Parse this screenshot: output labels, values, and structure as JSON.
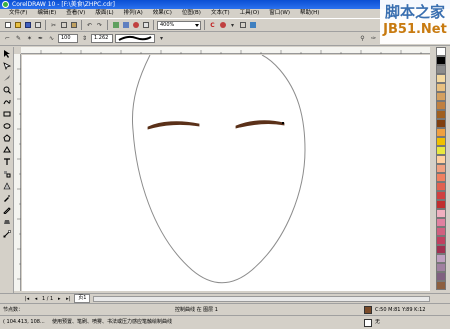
{
  "window": {
    "title": "CorelDRAW 10 - [F:\\美食\\ZHPC.cdr]"
  },
  "menu": [
    "文件(F)",
    "编辑(E)",
    "查看(V)",
    "版面(L)",
    "排列(A)",
    "效果(C)",
    "位图(B)",
    "文本(T)",
    "工具(O)",
    "窗口(W)",
    "帮助(H)"
  ],
  "toolbar": {
    "zoom_value": "400%"
  },
  "property_bar": {
    "width_value": "100",
    "size_value": "1.262"
  },
  "page_nav": {
    "page_counter": "1 / 1",
    "page_tab": "页1"
  },
  "status": {
    "node_info": "节点数：",
    "object_info": "控制曲线 在 图层 1",
    "coords": "( 104.413, 108...",
    "hint": "使用预置、笔刷、喷雾、书法或压力感应笔触绘制曲线",
    "fill_info": "C:50 M:81 Y:89 K:12",
    "outline_info": "无"
  },
  "watermark": {
    "cn": "脚本之家",
    "en": "JB51.Net"
  },
  "palette_colors": [
    "#ffffff",
    "#000000",
    "#8c8c8c",
    "#f4d9a0",
    "#e8c080",
    "#d4a060",
    "#c08040",
    "#a06020",
    "#804010",
    "#f0a040",
    "#f0c000",
    "#e8e840",
    "#ffd0a0",
    "#f0a080",
    "#f08060",
    "#e06050",
    "#d04040",
    "#c03030",
    "#f0b0c0",
    "#e080a0",
    "#d06080",
    "#c04060",
    "#a03050",
    "#c0a0c0",
    "#a080a0",
    "#806080",
    "#8c6040"
  ],
  "colors": {
    "eyebrow": "#5a3018",
    "face_outline": "#8c8c8c",
    "title_bar": "#0a4fd4",
    "fill_swatch": "#7a4a28"
  }
}
